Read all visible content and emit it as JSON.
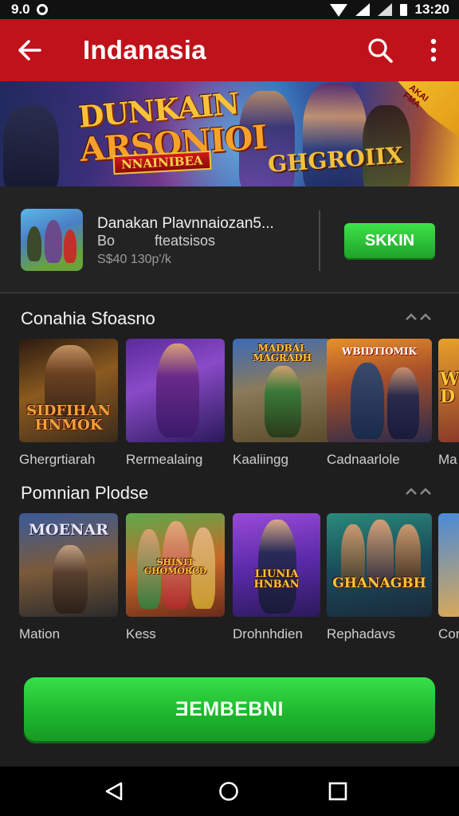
{
  "status_bar": {
    "left_text": "9.0",
    "time": "13:20"
  },
  "app_bar": {
    "title": "Indanasia"
  },
  "banner": {
    "title_line1": "DUNKAIN",
    "title_line2": "ARSONIOI",
    "tag": "NNAINIBEA",
    "title_right": "GHGROIIX",
    "corner_text": "AKAI\nFMA"
  },
  "featured": {
    "title": "Danakan Plavnnaiozan5...",
    "subtitle": "Bo          fteatsisos",
    "meta": "S$40 130p'/k",
    "button_label": "SKKIN"
  },
  "sections": [
    {
      "title": "Conahia Sfoasno",
      "items": [
        {
          "label": "Ghergrtiarah",
          "logo": "SIDFIHAN\nHNMOK"
        },
        {
          "label": "Rermealaing",
          "logo": ""
        },
        {
          "label": "Kaaliingg",
          "logo": "MADBAL\nMAGRADH"
        },
        {
          "label": "Cadnaarlole",
          "logo": "WBIDTIOMIK"
        },
        {
          "label": "Ma",
          "logo": "W\nD"
        }
      ]
    },
    {
      "title": "Pomnian Plodse",
      "items": [
        {
          "label": "Mation",
          "logo": "MOENAR"
        },
        {
          "label": "Kess",
          "logo": "SHINIT\nGHOMORCD"
        },
        {
          "label": "Drohnhdien",
          "logo": "LIUNIA\nHNBAN"
        },
        {
          "label": "Rephadavs",
          "logo": "GHANAGBH"
        },
        {
          "label": "Cor",
          "logo": ""
        }
      ]
    }
  ],
  "cta": {
    "label": "ƎEMBEBNI"
  },
  "colors": {
    "brand": "#c0121a",
    "accent_green": "#1fb52c",
    "background": "#1e1e1f"
  },
  "icons": [
    "back-arrow",
    "search",
    "more-vertical",
    "nav-back",
    "nav-home",
    "nav-recent"
  ]
}
